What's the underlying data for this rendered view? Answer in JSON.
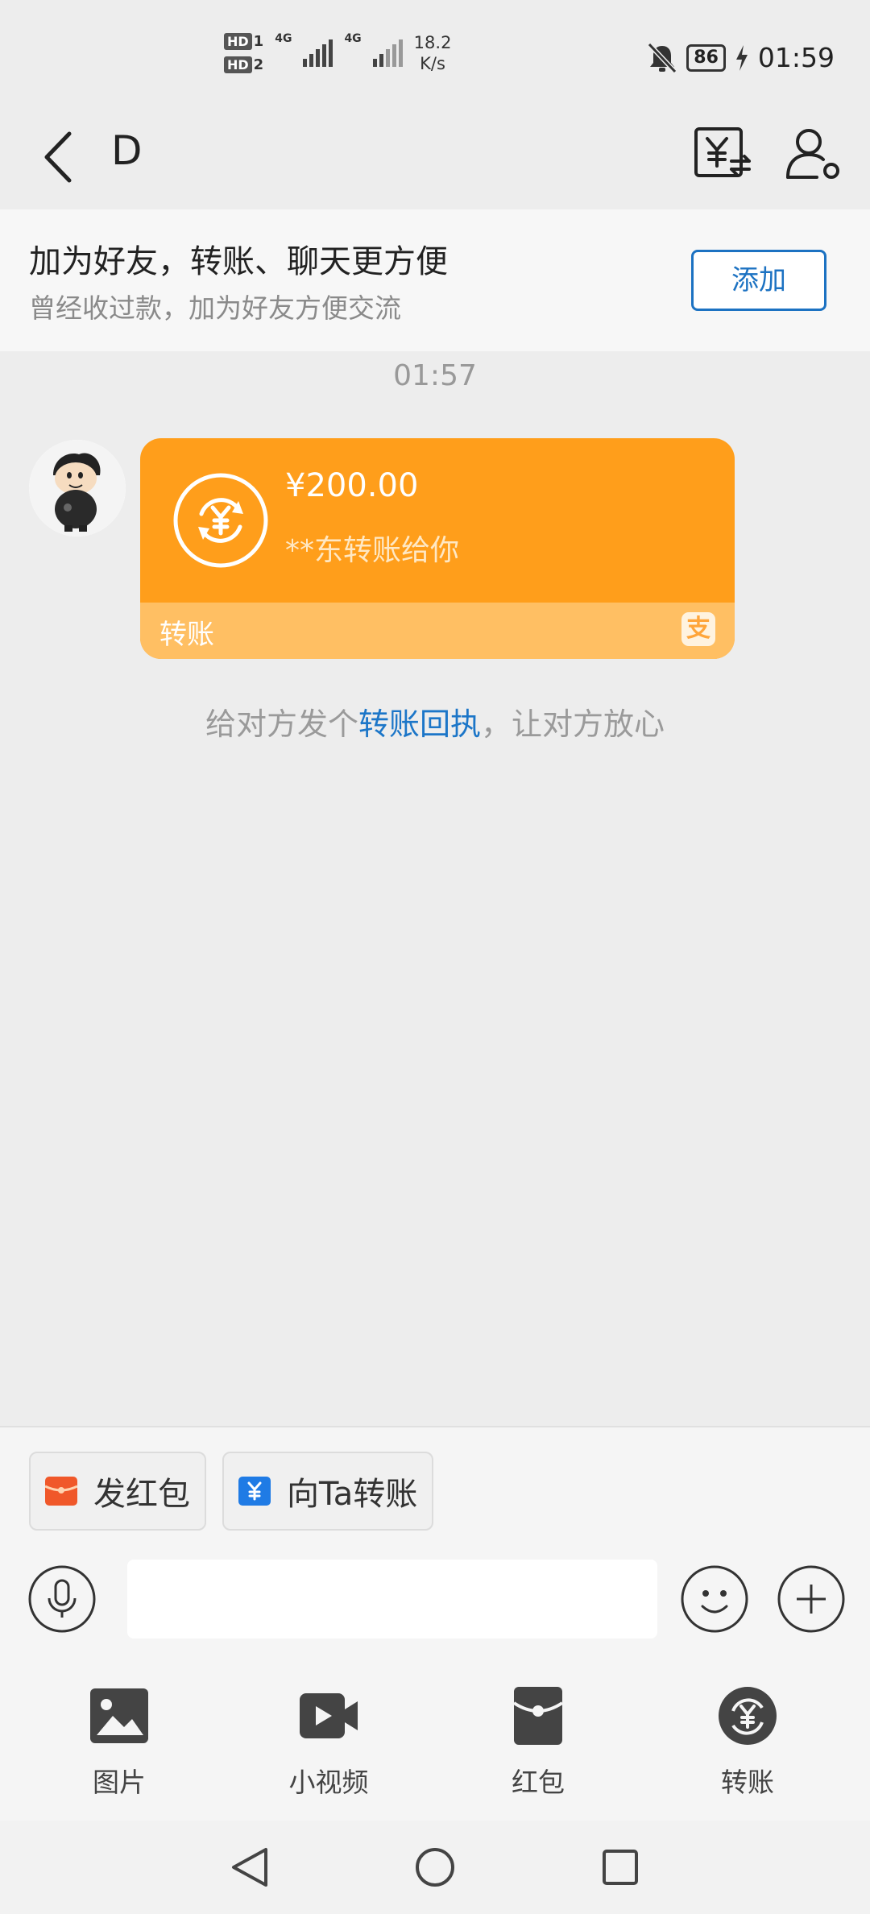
{
  "status_bar": {
    "hd1": "HD",
    "hd1_sub": "1",
    "hd2": "HD",
    "hd2_sub": "2",
    "net1": "4G",
    "net2": "4G",
    "speed_value": "18.2",
    "speed_unit": "K/s",
    "battery": "86",
    "time": "01:59"
  },
  "header": {
    "title": "D"
  },
  "banner": {
    "title": "加为好友，转账、聊天更方便",
    "subtitle": "曾经收过款，加为好友方便交流",
    "add_label": "添加"
  },
  "chat": {
    "timestamp": "01:57",
    "transfer": {
      "amount": "¥200.00",
      "from_text": "**东转账给你",
      "footer_label": "转账",
      "brand_glyph": "支"
    },
    "hint_prefix": "给对方发个",
    "hint_link": "转账回执",
    "hint_suffix": "，让对方放心"
  },
  "quick_actions": {
    "red_packet": "发红包",
    "transfer_to": "向Ta转账"
  },
  "input": {
    "placeholder": ""
  },
  "tools": [
    {
      "label": "图片",
      "icon": "image-icon"
    },
    {
      "label": "小视频",
      "icon": "video-icon"
    },
    {
      "label": "红包",
      "icon": "red-packet-icon"
    },
    {
      "label": "转账",
      "icon": "transfer-icon"
    }
  ],
  "colors": {
    "bubble": "#ff9e1b",
    "bubble_footer": "#ffbf63",
    "link": "#1c76c8"
  }
}
